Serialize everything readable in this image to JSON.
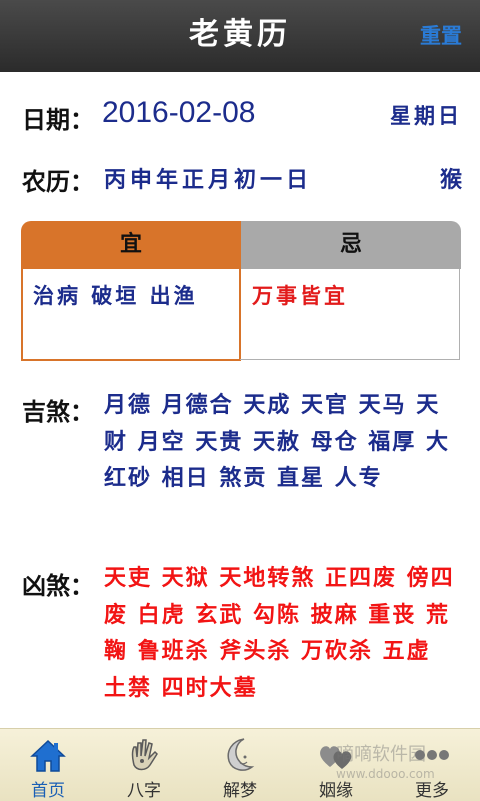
{
  "header": {
    "title": "老黄历",
    "reset_label": "重置"
  },
  "date": {
    "label": "日期：",
    "value": "2016-02-08",
    "weekday": "星期日"
  },
  "lunar": {
    "label": "农历：",
    "value": "丙申年正月初一日",
    "zodiac": "猴"
  },
  "yi_ji": {
    "yi_header": "宜",
    "ji_header": "忌",
    "yi_text": "治病 破垣 出渔",
    "ji_text": "万事皆宜"
  },
  "auspicious": {
    "label": "吉煞：",
    "text": "月德 月德合 天成 天官 天马 天财 月空 天贵 天赦 母仓 福厚 大红砂 相日 煞贡 直星 人专"
  },
  "inauspicious": {
    "label": "凶煞：",
    "text": "天吏 天狱 天地转煞 正四废 傍四废 白虎 玄武 勾陈 披麻 重丧 荒鞠 鲁班杀 斧头杀 万砍杀 五虚 土禁 四时大墓"
  },
  "nav": {
    "items": [
      {
        "label": "首页",
        "icon": "home-icon"
      },
      {
        "label": "八字",
        "icon": "hand-icon"
      },
      {
        "label": "解梦",
        "icon": "moon-icon"
      },
      {
        "label": "姻缘",
        "icon": "hearts-icon"
      },
      {
        "label": "更多",
        "icon": "more-icon"
      }
    ],
    "active": "首页"
  },
  "watermark": {
    "line1": "嘀嘀软件园",
    "line2": "www.ddooo.com"
  },
  "colors": {
    "header_bg": "#2b2b2b",
    "accent_blue": "#1c2c8c",
    "alert_red": "#f21414",
    "yi_orange": "#d8742a",
    "ji_gray": "#a9a9a9"
  }
}
